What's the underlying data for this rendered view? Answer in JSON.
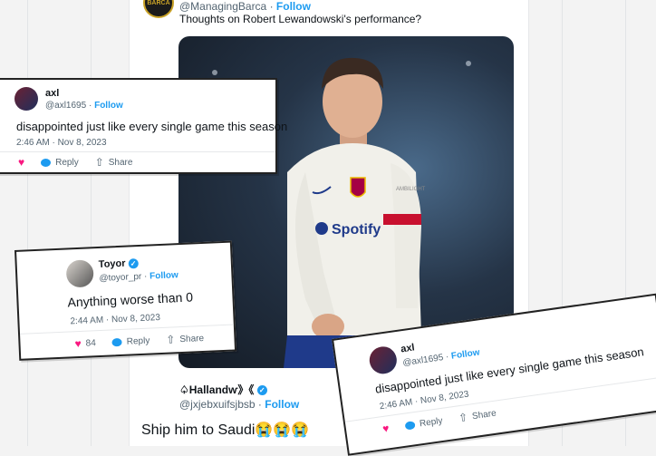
{
  "colors": {
    "accent": "#1d9bf0",
    "like": "#f91880",
    "text": "#0f1419",
    "muted": "#536471"
  },
  "background_tweet": {
    "avatar_text": "BARCA",
    "handle": "@ManagingBarca",
    "separator": "·",
    "follow": "Follow",
    "text": "Thoughts on Robert Lewandowski's performance?",
    "photo": {
      "kit_sponsor": "Spotify",
      "kit_brand": "AMBILIGHT"
    }
  },
  "background_reply": {
    "name": "♤Hallandⱳ》《",
    "handle": "@jxjebxuifsjbsb",
    "separator": "·",
    "follow": "Follow",
    "text": "Ship him to Saudi😭😭😭"
  },
  "card_top": {
    "name": "axl",
    "handle": "@axl1695",
    "separator": "·",
    "follow": "Follow",
    "text": "disappointed just like every single game this season",
    "time": "2:46 AM · Nov 8, 2023",
    "reply_label": "Reply",
    "share_label": "Share"
  },
  "card_mid": {
    "name": "Toyor",
    "handle": "@toyor_pr",
    "separator": "·",
    "follow": "Follow",
    "text": "Anything worse than 0",
    "time": "2:44 AM · Nov 8, 2023",
    "like_count": "84",
    "reply_label": "Reply",
    "share_label": "Share"
  },
  "card_bottom": {
    "name": "axl",
    "handle": "@axl1695",
    "separator": "·",
    "follow": "Follow",
    "text": "disappointed just like every single game this season",
    "time": "2:46 AM · Nov 8, 2023",
    "reply_label": "Reply",
    "share_label": "Share"
  }
}
